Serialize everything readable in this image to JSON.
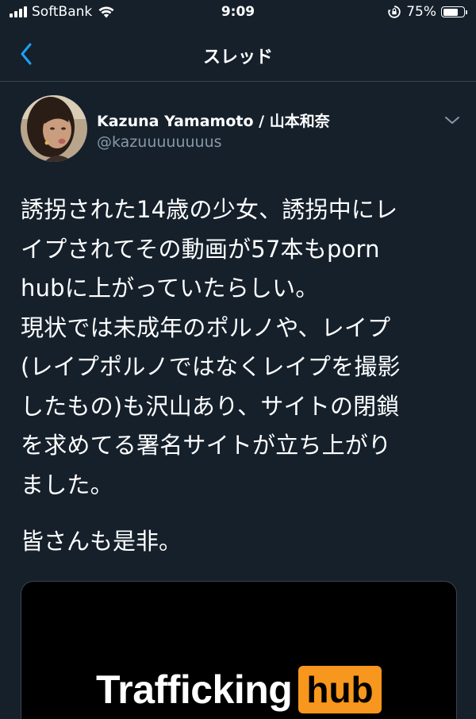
{
  "status_bar": {
    "carrier": "SoftBank",
    "time": "9:09",
    "battery_percent": "75%",
    "battery_level": 0.75,
    "icons": [
      "signal-icon",
      "wifi-icon",
      "orientation-lock-icon",
      "battery-icon"
    ]
  },
  "nav": {
    "back_icon": "chevron-left-icon",
    "title": "スレッド"
  },
  "tweet": {
    "display_name": "Kazuna Yamamoto / 山本和奈",
    "handle": "@kazuuuuuuuus",
    "menu_icon": "chevron-down-icon",
    "body_lines": [
      "誘拐された14歳の少女、誘拐中にレ",
      "イプされてその動画が57本もporn",
      "hubに上がっていたらしい。",
      "現状では未成年のポルノや、レイプ",
      "(レイプポルノではなくレイプを撮影",
      "したもの)も沢山あり、サイトの閉鎖",
      "を求めてる署名サイトが立ち上がり",
      "ました。"
    ],
    "body_para2": "皆さんも是非。",
    "media": {
      "logo_text_white": "Trafficking",
      "logo_text_orange": "hub",
      "accent_color": "#f7971d"
    }
  },
  "theme": {
    "background": "#15202b",
    "accent": "#1da1f2",
    "secondary_text": "#8899a6",
    "divider": "#38444d"
  }
}
